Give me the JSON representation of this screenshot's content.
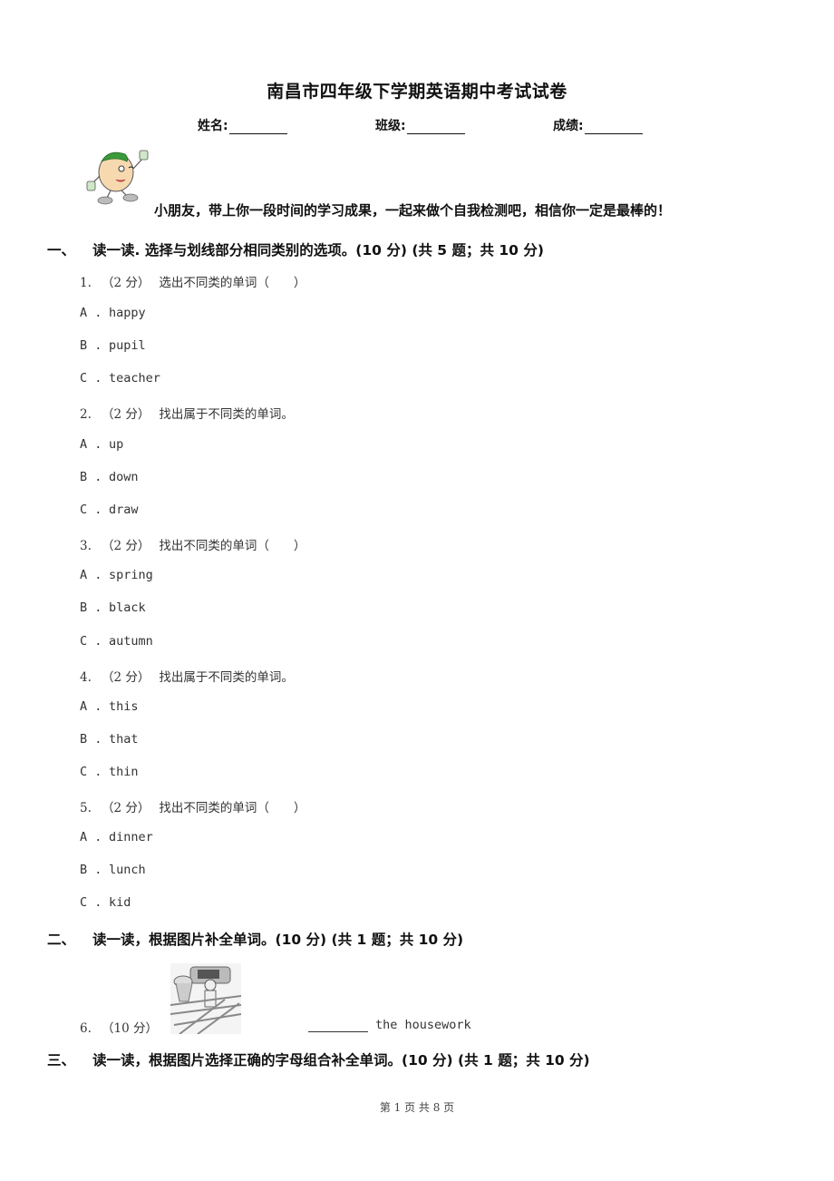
{
  "document": {
    "title": "南昌市四年级下学期英语期中考试试卷",
    "fields": [
      {
        "label": "姓名:",
        "value": ""
      },
      {
        "label": "班级:",
        "value": ""
      },
      {
        "label": "成绩:",
        "value": ""
      }
    ],
    "mascot_icon": "cartoon-mascot-icon",
    "encouragement": "小朋友，带上你一段时间的学习成果，一起来做个自我检测吧，相信你一定是最棒的！"
  },
  "sections": [
    {
      "number": "一、",
      "heading": "读一读. 选择与划线部分相同类别的选项。(10 分) (共 5 题；共 10 分)",
      "questions": [
        {
          "number": "1.",
          "points": "（2 分）",
          "prompt": "选出不同类的单词（　　）",
          "options": [
            {
              "letter": "A .",
              "text": "happy"
            },
            {
              "letter": "B .",
              "text": "pupil"
            },
            {
              "letter": "C .",
              "text": "teacher"
            }
          ]
        },
        {
          "number": "2.",
          "points": "（2 分）",
          "prompt": "找出属于不同类的单词。",
          "options": [
            {
              "letter": "A .",
              "text": "up"
            },
            {
              "letter": "B .",
              "text": "down"
            },
            {
              "letter": "C .",
              "text": "draw"
            }
          ]
        },
        {
          "number": "3.",
          "points": "（2 分）",
          "prompt": "找出不同类的单词（　　）",
          "options": [
            {
              "letter": "A .",
              "text": "spring"
            },
            {
              "letter": "B .",
              "text": "black"
            },
            {
              "letter": "C .",
              "text": "autumn"
            }
          ]
        },
        {
          "number": "4.",
          "points": "（2 分）",
          "prompt": "找出属于不同类的单词。",
          "options": [
            {
              "letter": "A .",
              "text": "this"
            },
            {
              "letter": "B .",
              "text": "that"
            },
            {
              "letter": "C .",
              "text": "thin"
            }
          ]
        },
        {
          "number": "5.",
          "points": "（2 分）",
          "prompt": "找出不同类的单词（　　）",
          "options": [
            {
              "letter": "A .",
              "text": "dinner"
            },
            {
              "letter": "B .",
              "text": "lunch"
            },
            {
              "letter": "C .",
              "text": "kid"
            }
          ]
        }
      ]
    },
    {
      "number": "二、",
      "heading": "读一读，根据图片补全单词。(10 分) (共 1 题；共 10 分)",
      "questions": [
        {
          "number": "6.",
          "points": "（10 分）",
          "picture_icon": "housework-picture-icon",
          "answer_value": "",
          "suffix": "the housework"
        }
      ]
    },
    {
      "number": "三、",
      "heading": "读一读，根据图片选择正确的字母组合补全单词。(10 分) (共 1 题；共 10 分)",
      "questions": []
    }
  ],
  "footer": {
    "page_label": "第 1 页 共 8 页"
  }
}
